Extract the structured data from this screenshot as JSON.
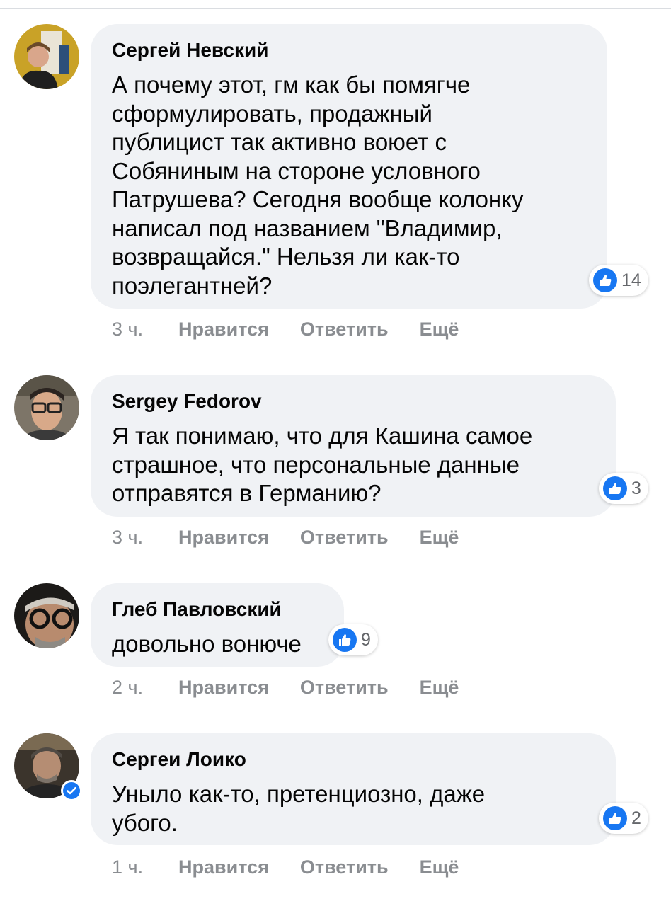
{
  "comments": [
    {
      "author": "Сергей Невский",
      "text": "А почему этот, гм как бы помягче\nсформулировать, продажный\nпублицист так активно воюет с\nСобяниным на стороне условного\nПатрушева? Сегодня вообще колонку\nнаписал под названием \"Владимир,\nвозвращайся.\" Нельзя ли как-то\nпоэлегантней?",
      "likes": "14",
      "time": "3 ч.",
      "like_label": "Нравится",
      "reply_label": "Ответить",
      "more_label": "Ещё",
      "verified": false
    },
    {
      "author": "Sergey Fedorov",
      "text": "Я так понимаю, что для Кашина самое\nстрашное, что персональные данные\nотправятся в Германию?",
      "likes": "3",
      "time": "3 ч.",
      "like_label": "Нравится",
      "reply_label": "Ответить",
      "more_label": "Ещё",
      "verified": false
    },
    {
      "author": "Глеб Павловский",
      "text": "довольно вонюче",
      "likes": "9",
      "time": "2 ч.",
      "like_label": "Нравится",
      "reply_label": "Ответить",
      "more_label": "Ещё",
      "verified": false
    },
    {
      "author": "Сергеи Лоико",
      "text": "Уныло как-то, претенциозно, даже\nубого.",
      "likes": "2",
      "time": "1 ч.",
      "like_label": "Нравится",
      "reply_label": "Ответить",
      "more_label": "Ещё",
      "verified": true
    }
  ],
  "colors": {
    "like_blue": "#1877f2",
    "bubble_bg": "#f0f2f5",
    "meta_gray": "#8a8d91"
  },
  "icons": {
    "reaction": "thumbs-up-icon",
    "verified": "verified-badge-icon"
  }
}
